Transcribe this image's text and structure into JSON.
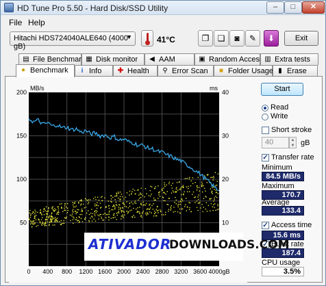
{
  "window": {
    "title": "HD Tune Pro 5.50 - Hard Disk/SSD Utility",
    "min": "–",
    "max": "□",
    "close": "✕"
  },
  "menu": {
    "file": "File",
    "help": "Help"
  },
  "toolbar": {
    "drive": "Hitachi HDS724040ALE640 (4000 gB)",
    "temperature": "41°C",
    "exit": "Exit"
  },
  "tabs_top": [
    "File Benchmark",
    "Disk monitor",
    "AAM",
    "Random Access",
    "Extra tests"
  ],
  "tabs_bottom": [
    "Benchmark",
    "Info",
    "Health",
    "Error Scan",
    "Folder Usage",
    "Erase"
  ],
  "controls": {
    "start": "Start",
    "read": "Read",
    "write": "Write",
    "short_stroke": "Short stroke",
    "short_stroke_value": "40",
    "short_stroke_unit": "gB",
    "transfer_rate": "Transfer rate",
    "minimum_label": "Minimum",
    "minimum": "84.5 MB/s",
    "maximum_label": "Maximum",
    "maximum": "170.7 MB/s",
    "average_label": "Average",
    "average": "133.4 MB/s",
    "access_time_label": "Access time",
    "access_time": "15.6 ms",
    "burst_rate_label": "Burst rate",
    "burst_rate": "187.4 MB/s",
    "cpu_usage_label": "CPU usage",
    "cpu_usage": "3.5%"
  },
  "watermark": {
    "part1": "ATIVADOR",
    "part2": "DOWNLOADS.COM"
  },
  "chart_data": {
    "type": "line",
    "ylabel_left": "MB/s",
    "ylabel_right": "ms",
    "xlim": [
      0,
      4000
    ],
    "ylim_left": [
      0,
      200
    ],
    "ylim_right": [
      0,
      40
    ],
    "x_ticks": [
      "0",
      "400",
      "800",
      "1200",
      "1600",
      "2000",
      "2400",
      "2800",
      "3200",
      "3600",
      "4000gB"
    ],
    "y_ticks_left": [
      "50",
      "100",
      "150",
      "200"
    ],
    "y_ticks_right": [
      "10",
      "20",
      "30",
      "40"
    ],
    "grid": true,
    "background": "#000000",
    "series": [
      {
        "kind": "transfer-rate",
        "color": "#3aa8e8",
        "axis": "left",
        "x": [
          0,
          100,
          200,
          300,
          400,
          500,
          600,
          700,
          800,
          900,
          1000,
          1100,
          1200,
          1300,
          1400,
          1500,
          1600,
          1700,
          1800,
          1900,
          2000,
          2100,
          2200,
          2300,
          2400,
          2500,
          2600,
          2700,
          2800,
          2900,
          3000,
          3100,
          3200,
          3300,
          3400,
          3500,
          3600,
          3700,
          3800,
          3900,
          4000
        ],
        "y": [
          170,
          166,
          168,
          163,
          165,
          161,
          163,
          159,
          160,
          157,
          158,
          154,
          156,
          152,
          153,
          150,
          151,
          148,
          149,
          145,
          146,
          143,
          142,
          139,
          139,
          136,
          135,
          132,
          131,
          128,
          126,
          123,
          121,
          117,
          114,
          110,
          106,
          101,
          96,
          91,
          87
        ]
      },
      {
        "kind": "access-time",
        "color": "#e8e83a",
        "axis": "right",
        "x_range": [
          0,
          4000
        ],
        "y_min_start": 9,
        "y_max_start": 13,
        "y_min_end": 13,
        "y_max_end": 22
      }
    ]
  }
}
